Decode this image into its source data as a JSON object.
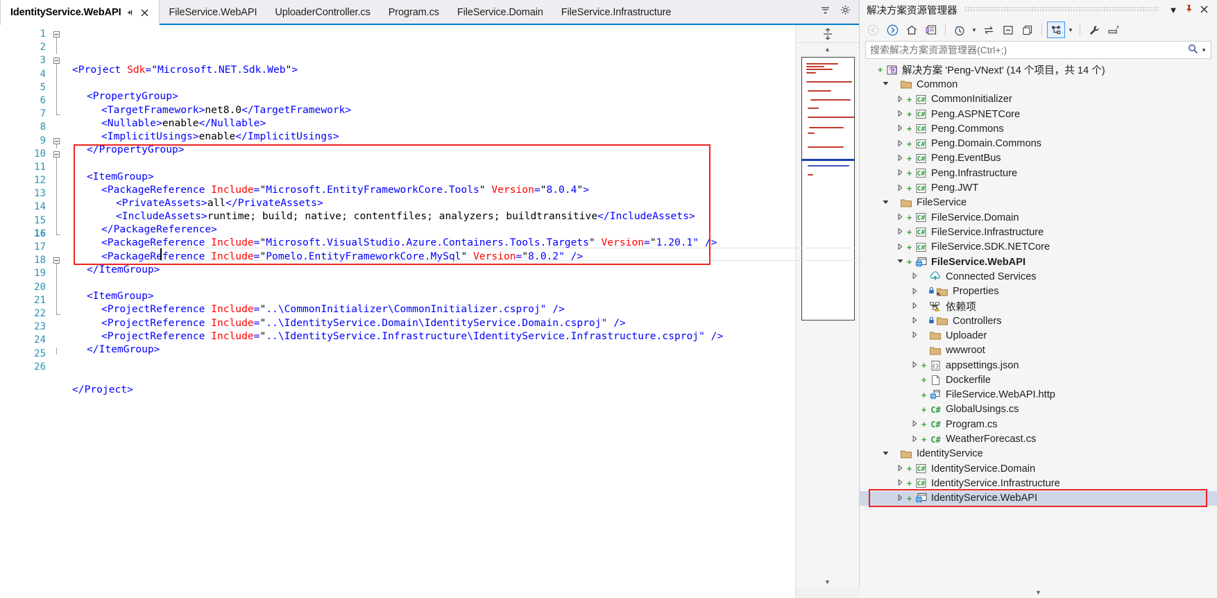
{
  "tabs": [
    {
      "label": "IdentityService.WebAPI",
      "active": true,
      "pin": "pin-icon",
      "close": "close-icon"
    },
    {
      "label": "FileService.WebAPI",
      "active": false
    },
    {
      "label": "UploaderController.cs",
      "active": false
    },
    {
      "label": "Program.cs",
      "active": false
    },
    {
      "label": "FileService.Domain",
      "active": false
    },
    {
      "label": "FileService.Infrastructure",
      "active": false
    }
  ],
  "tab_overflow": {
    "dropdown_icon": "chevron-down-icon",
    "settings_icon": "gear-icon"
  },
  "editor": {
    "line_numbers": [
      1,
      2,
      3,
      4,
      5,
      6,
      7,
      8,
      9,
      10,
      11,
      12,
      13,
      14,
      15,
      16,
      17,
      18,
      19,
      20,
      21,
      22,
      23,
      24,
      25,
      26
    ],
    "current_line": 16,
    "lines": [
      {
        "n": 1,
        "indent": 0,
        "parts": [
          {
            "t": "<Project ",
            "c": "tag"
          },
          {
            "t": "Sdk",
            "c": "attr"
          },
          {
            "t": "=",
            "c": "tag"
          },
          {
            "t": "\"",
            "c": "q"
          },
          {
            "t": "Microsoft.NET.Sdk.Web",
            "c": "val"
          },
          {
            "t": "\"",
            "c": "q"
          },
          {
            "t": ">",
            "c": "tag"
          }
        ]
      },
      {
        "n": 2,
        "indent": 0,
        "parts": []
      },
      {
        "n": 3,
        "indent": 1,
        "parts": [
          {
            "t": "<PropertyGroup>",
            "c": "tag"
          }
        ]
      },
      {
        "n": 4,
        "indent": 2,
        "parts": [
          {
            "t": "<TargetFramework>",
            "c": "tag"
          },
          {
            "t": "net8.0",
            "c": "txt"
          },
          {
            "t": "</TargetFramework>",
            "c": "tag"
          }
        ]
      },
      {
        "n": 5,
        "indent": 2,
        "parts": [
          {
            "t": "<Nullable>",
            "c": "tag"
          },
          {
            "t": "enable",
            "c": "txt"
          },
          {
            "t": "</Nullable>",
            "c": "tag"
          }
        ]
      },
      {
        "n": 6,
        "indent": 2,
        "parts": [
          {
            "t": "<ImplicitUsings>",
            "c": "tag"
          },
          {
            "t": "enable",
            "c": "txt"
          },
          {
            "t": "</ImplicitUsings>",
            "c": "tag"
          }
        ]
      },
      {
        "n": 7,
        "indent": 1,
        "parts": [
          {
            "t": "</PropertyGroup>",
            "c": "tag"
          }
        ]
      },
      {
        "n": 8,
        "indent": 0,
        "parts": []
      },
      {
        "n": 9,
        "indent": 1,
        "parts": [
          {
            "t": "<ItemGroup>",
            "c": "tag"
          }
        ]
      },
      {
        "n": 10,
        "indent": 2,
        "parts": [
          {
            "t": "<PackageReference ",
            "c": "tag"
          },
          {
            "t": "Include",
            "c": "attr"
          },
          {
            "t": "=",
            "c": "tag"
          },
          {
            "t": "\"",
            "c": "q"
          },
          {
            "t": "Microsoft.EntityFrameworkCore.Tools",
            "c": "val"
          },
          {
            "t": "\" ",
            "c": "q"
          },
          {
            "t": "Version",
            "c": "attr"
          },
          {
            "t": "=",
            "c": "tag"
          },
          {
            "t": "\"",
            "c": "q"
          },
          {
            "t": "8.0.4",
            "c": "val"
          },
          {
            "t": "\"",
            "c": "q"
          },
          {
            "t": ">",
            "c": "tag"
          }
        ]
      },
      {
        "n": 11,
        "indent": 3,
        "parts": [
          {
            "t": "<PrivateAssets>",
            "c": "tag"
          },
          {
            "t": "all",
            "c": "txt"
          },
          {
            "t": "</PrivateAssets>",
            "c": "tag"
          }
        ]
      },
      {
        "n": 12,
        "indent": 3,
        "parts": [
          {
            "t": "<IncludeAssets>",
            "c": "tag"
          },
          {
            "t": "runtime; build; native; contentfiles; analyzers; buildtransitive",
            "c": "txt"
          },
          {
            "t": "</IncludeAssets>",
            "c": "tag"
          }
        ]
      },
      {
        "n": 13,
        "indent": 2,
        "parts": [
          {
            "t": "</PackageReference>",
            "c": "tag"
          }
        ]
      },
      {
        "n": 14,
        "indent": 2,
        "parts": [
          {
            "t": "<PackageReference ",
            "c": "tag"
          },
          {
            "t": "Include",
            "c": "attr"
          },
          {
            "t": "=",
            "c": "tag"
          },
          {
            "t": "\"",
            "c": "q"
          },
          {
            "t": "Microsoft.VisualStudio.Azure.Containers.Tools.Targets",
            "c": "val"
          },
          {
            "t": "\" ",
            "c": "q"
          },
          {
            "t": "Version",
            "c": "attr"
          },
          {
            "t": "=",
            "c": "tag"
          },
          {
            "t": "\"",
            "c": "q"
          },
          {
            "t": "1.20.1",
            "c": "val"
          },
          {
            "t": "\" />",
            "c": "tag"
          }
        ]
      },
      {
        "n": 15,
        "indent": 2,
        "parts": [
          {
            "t": "<PackageReference ",
            "c": "tag"
          },
          {
            "t": "Include",
            "c": "attr"
          },
          {
            "t": "=",
            "c": "tag"
          },
          {
            "t": "\"",
            "c": "q"
          },
          {
            "t": "Pomelo.EntityFrameworkCore.MySql",
            "c": "val"
          },
          {
            "t": "\" ",
            "c": "q"
          },
          {
            "t": "Version",
            "c": "attr"
          },
          {
            "t": "=",
            "c": "tag"
          },
          {
            "t": "\"",
            "c": "q"
          },
          {
            "t": "8.0.2",
            "c": "val"
          },
          {
            "t": "\" />",
            "c": "tag"
          }
        ]
      },
      {
        "n": 16,
        "indent": 1,
        "parts": [
          {
            "t": "</ItemGroup>",
            "c": "tag"
          }
        ]
      },
      {
        "n": 17,
        "indent": 0,
        "parts": []
      },
      {
        "n": 18,
        "indent": 1,
        "parts": [
          {
            "t": "<ItemGroup>",
            "c": "tag"
          }
        ]
      },
      {
        "n": 19,
        "indent": 2,
        "parts": [
          {
            "t": "<ProjectReference ",
            "c": "tag"
          },
          {
            "t": "Include",
            "c": "attr"
          },
          {
            "t": "=",
            "c": "tag"
          },
          {
            "t": "\"",
            "c": "q"
          },
          {
            "t": "..\\CommonInitializer\\CommonInitializer.csproj",
            "c": "val"
          },
          {
            "t": "\" />",
            "c": "tag"
          }
        ]
      },
      {
        "n": 20,
        "indent": 2,
        "parts": [
          {
            "t": "<ProjectReference ",
            "c": "tag"
          },
          {
            "t": "Include",
            "c": "attr"
          },
          {
            "t": "=",
            "c": "tag"
          },
          {
            "t": "\"",
            "c": "q"
          },
          {
            "t": "..\\IdentityService.Domain\\IdentityService.Domain.csproj",
            "c": "val"
          },
          {
            "t": "\" />",
            "c": "tag"
          }
        ]
      },
      {
        "n": 21,
        "indent": 2,
        "parts": [
          {
            "t": "<ProjectReference ",
            "c": "tag"
          },
          {
            "t": "Include",
            "c": "attr"
          },
          {
            "t": "=",
            "c": "tag"
          },
          {
            "t": "\"",
            "c": "q"
          },
          {
            "t": "..\\IdentityService.Infrastructure\\IdentityService.Infrastructure.csproj",
            "c": "val"
          },
          {
            "t": "\" />",
            "c": "tag"
          }
        ]
      },
      {
        "n": 22,
        "indent": 1,
        "parts": [
          {
            "t": "</ItemGroup>",
            "c": "tag"
          }
        ]
      },
      {
        "n": 23,
        "indent": 0,
        "parts": []
      },
      {
        "n": 24,
        "indent": 0,
        "parts": []
      },
      {
        "n": 25,
        "indent": 0,
        "parts": [
          {
            "t": "</Project>",
            "c": "tag"
          }
        ]
      },
      {
        "n": 26,
        "indent": 0,
        "parts": []
      }
    ],
    "highlight_box": {
      "color": "#ee2222",
      "from_line": 9,
      "to_line": 16
    },
    "colors": {
      "tag": "#0000ff",
      "attr": "#ff0000",
      "value": "#0000ff",
      "text": "#000000",
      "line_number": "#2b91af",
      "accent": "#007acc"
    }
  },
  "map_column": {
    "split_icon": "split-view-icon",
    "scroll_up_icon": "chevron-up-icon",
    "scroll_down_icon": "chevron-down-icon"
  },
  "solution_explorer": {
    "title": "解决方案资源管理器",
    "title_buttons": [
      {
        "name": "dropdown-icon",
        "glyph": "▼"
      },
      {
        "name": "pin-icon",
        "glyph": "⚲"
      },
      {
        "name": "close-icon",
        "glyph": "✕"
      }
    ],
    "toolbar": [
      {
        "name": "back-button",
        "disabled": true
      },
      {
        "name": "forward-button",
        "disabled": false
      },
      {
        "name": "home-button",
        "disabled": false
      },
      {
        "name": "solution-explorer-view-button",
        "disabled": false
      },
      {
        "name": "pending-changes-button",
        "disabled": false
      },
      {
        "name": "sync-with-active-document-button",
        "disabled": false
      },
      {
        "name": "collapse-all-button",
        "disabled": false
      },
      {
        "name": "show-all-files-button",
        "disabled": false
      },
      {
        "name": "properties-view-button",
        "disabled": false,
        "active": true
      },
      {
        "name": "properties-button",
        "disabled": false
      },
      {
        "name": "preview-selected-items-button",
        "disabled": false
      }
    ],
    "search": {
      "placeholder": "搜索解决方案资源管理器(Ctrl+;)",
      "value": ""
    },
    "tree": [
      {
        "depth": 0,
        "arrow": "plus-sc",
        "icon": "solution-icon",
        "label": "解决方案 'Peng-VNext' (14 个项目，共 14 个)",
        "sc": true,
        "expand": "none"
      },
      {
        "depth": 1,
        "expand": "open",
        "icon": "folder-icon",
        "label": "Common"
      },
      {
        "depth": 2,
        "expand": "closed",
        "sc": true,
        "icon": "csharp-project-icon",
        "label": "CommonInitializer"
      },
      {
        "depth": 2,
        "expand": "closed",
        "sc": true,
        "icon": "csharp-project-icon",
        "label": "Peng.ASPNETCore"
      },
      {
        "depth": 2,
        "expand": "closed",
        "sc": true,
        "icon": "csharp-project-icon",
        "label": "Peng.Commons"
      },
      {
        "depth": 2,
        "expand": "closed",
        "sc": true,
        "icon": "csharp-project-icon",
        "label": "Peng.Domain.Commons"
      },
      {
        "depth": 2,
        "expand": "closed",
        "sc": true,
        "icon": "csharp-project-icon",
        "label": "Peng.EventBus"
      },
      {
        "depth": 2,
        "expand": "closed",
        "sc": true,
        "icon": "csharp-project-icon",
        "label": "Peng.Infrastructure"
      },
      {
        "depth": 2,
        "expand": "closed",
        "sc": true,
        "icon": "csharp-project-icon",
        "label": "Peng.JWT"
      },
      {
        "depth": 1,
        "expand": "open",
        "icon": "folder-icon",
        "label": "FileService"
      },
      {
        "depth": 2,
        "expand": "closed",
        "sc": true,
        "icon": "csharp-project-icon",
        "label": "FileService.Domain"
      },
      {
        "depth": 2,
        "expand": "closed",
        "sc": true,
        "icon": "csharp-project-icon",
        "label": "FileService.Infrastructure"
      },
      {
        "depth": 2,
        "expand": "closed",
        "sc": true,
        "icon": "csharp-project-icon",
        "label": "FileService.SDK.NETCore"
      },
      {
        "depth": 2,
        "expand": "open",
        "sc": true,
        "icon": "web-project-icon",
        "label": "FileService.WebAPI",
        "bold": true
      },
      {
        "depth": 3,
        "expand": "closed",
        "icon": "connected-services-icon",
        "label": "Connected Services"
      },
      {
        "depth": 3,
        "expand": "closed",
        "lock": true,
        "icon": "properties-folder-icon",
        "label": "Properties"
      },
      {
        "depth": 3,
        "expand": "closed",
        "icon": "dependencies-icon",
        "label": "依赖项"
      },
      {
        "depth": 3,
        "expand": "closed",
        "lock": true,
        "icon": "folder-icon",
        "label": "Controllers"
      },
      {
        "depth": 3,
        "expand": "closed",
        "icon": "folder-icon",
        "label": "Uploader"
      },
      {
        "depth": 3,
        "expand": "none",
        "icon": "folder-icon",
        "label": "wwwroot"
      },
      {
        "depth": 3,
        "expand": "closed",
        "sc": true,
        "icon": "json-file-icon",
        "label": "appsettings.json"
      },
      {
        "depth": 3,
        "expand": "none",
        "sc": true,
        "icon": "file-icon",
        "label": "Dockerfile"
      },
      {
        "depth": 3,
        "expand": "none",
        "sc": true,
        "icon": "http-file-icon",
        "label": "FileService.WebAPI.http"
      },
      {
        "depth": 3,
        "expand": "none",
        "sc": true,
        "icon": "csharp-file-icon",
        "label": "GlobalUsings.cs"
      },
      {
        "depth": 3,
        "expand": "closed",
        "sc": true,
        "icon": "csharp-file-icon",
        "label": "Program.cs"
      },
      {
        "depth": 3,
        "expand": "closed",
        "sc": true,
        "icon": "csharp-file-icon",
        "label": "WeatherForecast.cs"
      },
      {
        "depth": 1,
        "expand": "open",
        "icon": "folder-icon",
        "label": "IdentityService"
      },
      {
        "depth": 2,
        "expand": "closed",
        "sc": true,
        "icon": "csharp-project-icon",
        "label": "IdentityService.Domain"
      },
      {
        "depth": 2,
        "expand": "closed",
        "sc": true,
        "icon": "csharp-project-icon",
        "label": "IdentityService.Infrastructure"
      },
      {
        "depth": 2,
        "expand": "closed",
        "sc": true,
        "icon": "web-project-icon",
        "label": "IdentityService.WebAPI",
        "selected": true,
        "highlighted": true
      }
    ],
    "scroll_down_icon": "chevron-down-icon",
    "colors": {
      "selection": "#cfd6e6",
      "highlight_box": "#ee2222",
      "source_control_add": "#3aa63a",
      "folder": "#d9b47a"
    }
  }
}
